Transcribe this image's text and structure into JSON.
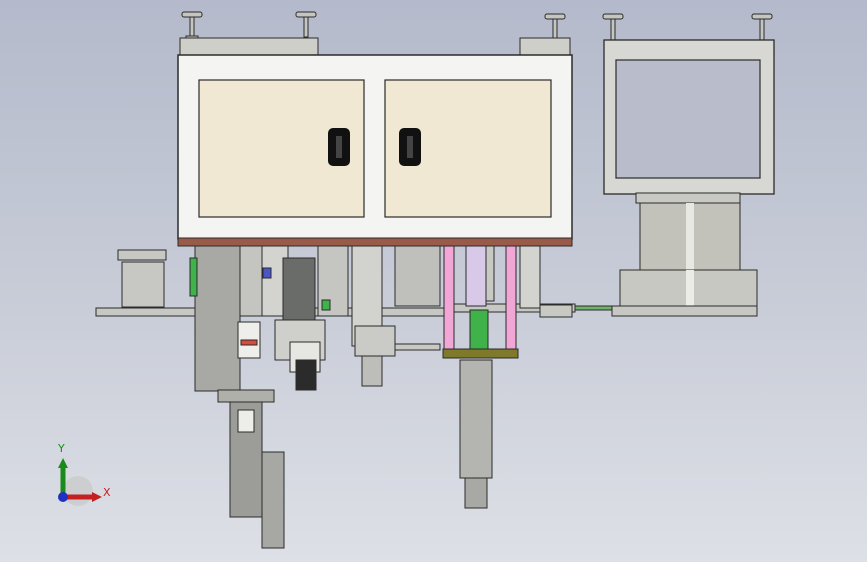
{
  "viewport": {
    "background": "gradient-gray",
    "model": "assembly-machine-front-view"
  },
  "colors": {
    "cabinet_frame": "#f4f4f2",
    "cabinet_door": "#f0e8d2",
    "handle": "#111111",
    "base_plate": "#9a5a4a",
    "steel": "#c8c8c2",
    "steel_dark": "#8f908c",
    "rod_pink": "#f2a6d6",
    "plate_olive": "#7f7a2a",
    "accent_green": "#3fb24a",
    "accent_blue": "#4a55c8"
  },
  "triad": {
    "x_label": "X",
    "y_label": "Y",
    "icon": "coordinate-triad-icon"
  }
}
